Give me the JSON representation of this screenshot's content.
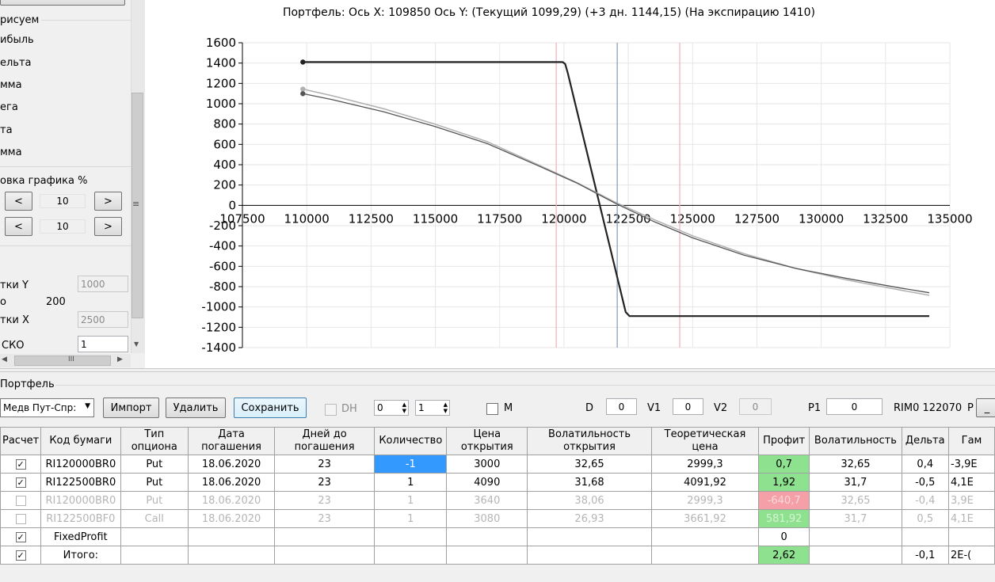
{
  "left_panel": {
    "group_title": "рисуем",
    "items": [
      "ибыль",
      "ельта",
      "мма",
      "ега",
      "та",
      "мма"
    ],
    "zoom_title": "овка графика %",
    "zoom_x": {
      "dec": "<",
      "value": "10",
      "inc": ">"
    },
    "zoom_y": {
      "dec": "<",
      "value": "10",
      "inc": ">"
    },
    "grid_y_label": "тки Y",
    "grid_y_value": "1000",
    "o_label": "о",
    "o_value": "200",
    "grid_x_label": "тки X",
    "grid_x_value": "2500",
    "sko_label": "СКО",
    "sko_value": "1",
    "hscroll_grip": "III",
    "vscroll_grip": "≡"
  },
  "chart": {
    "title": "Портфель: Ось X: 109850 Ось Y:  (Текущий 1099,29)  (+3 дн. 1144,15)  (На экспирацию 1410)"
  },
  "chart_data": {
    "type": "line",
    "title": "Портфель: Ось X: 109850 Ось Y:  (Текущий 1099,29)  (+3 дн. 1144,15)  (На экспирацию 1410)",
    "xlim": [
      107500,
      135000
    ],
    "ylim": [
      -1400,
      1600
    ],
    "x_ticks": [
      "107500",
      "110000",
      "112500",
      "115000",
      "117500",
      "120000",
      "122500",
      "125000",
      "127500",
      "130000",
      "132500",
      "135000"
    ],
    "y_ticks": [
      "1600",
      "1400",
      "1200",
      "1000",
      "800",
      "600",
      "400",
      "200",
      "0",
      "-200",
      "-400",
      "-600",
      "-800",
      "-1000",
      "-1200",
      "-1400"
    ],
    "grid": true,
    "vlines": [
      {
        "x": 119700,
        "color": "#f4b3bd"
      },
      {
        "x": 122070,
        "color": "#8aa0b6"
      },
      {
        "x": 124500,
        "color": "#f4b3bd"
      }
    ],
    "series": [
      {
        "color": "#222222",
        "width": 2.2,
        "marker_start": true,
        "points": [
          [
            109850,
            1410
          ],
          [
            119950,
            1410
          ],
          [
            120050,
            1390
          ],
          [
            120150,
            1300
          ],
          [
            122400,
            -1050
          ],
          [
            122550,
            -1090
          ],
          [
            134200,
            -1090
          ]
        ]
      },
      {
        "color": "#b0b0b0",
        "width": 1.5,
        "marker_start": true,
        "points": [
          [
            109850,
            1144
          ],
          [
            111000,
            1078
          ],
          [
            113000,
            950
          ],
          [
            115000,
            798
          ],
          [
            117000,
            628
          ],
          [
            119000,
            400
          ],
          [
            120500,
            225
          ],
          [
            122000,
            30
          ],
          [
            123500,
            -140
          ],
          [
            125000,
            -300
          ],
          [
            127000,
            -475
          ],
          [
            129000,
            -620
          ],
          [
            131000,
            -735
          ],
          [
            133000,
            -830
          ],
          [
            134200,
            -885
          ]
        ]
      },
      {
        "color": "#555555",
        "width": 1.3,
        "marker_start": true,
        "points": [
          [
            109850,
            1099
          ],
          [
            111000,
            1040
          ],
          [
            113000,
            920
          ],
          [
            115000,
            775
          ],
          [
            117000,
            610
          ],
          [
            119000,
            390
          ],
          [
            120500,
            220
          ],
          [
            122000,
            20
          ],
          [
            123500,
            -160
          ],
          [
            125000,
            -320
          ],
          [
            127000,
            -490
          ],
          [
            129000,
            -620
          ],
          [
            131000,
            -720
          ],
          [
            133000,
            -810
          ],
          [
            134200,
            -860
          ]
        ]
      }
    ]
  },
  "portfolio": {
    "title": "Портфель",
    "select_value": "Медв Пут-Спр:",
    "import_label": "Импорт",
    "delete_label": "Удалить",
    "save_label": "Сохранить",
    "dh_label": "DH",
    "spin1": "0",
    "spin2": "1",
    "m_label": "M",
    "d_label": "D",
    "d_value": "0",
    "v1_label": "V1",
    "v1_value": "0",
    "v2_label": "V2",
    "v2_value": "0",
    "p1_label": "P1",
    "p1_value": "0",
    "rim_label": "RIM0 122070",
    "p_label": "P",
    "p_btn": "_"
  },
  "table": {
    "headers": [
      "Расчет",
      "Код бумаги",
      "Тип\nопциона",
      "Дата\nпогашения",
      "Дней до\nпогашения",
      "Количество",
      "Цена\nоткрытия",
      "Волатильность\nоткрытия",
      "Теоретическая\nцена",
      "Профит",
      "Волатильность",
      "Дельта",
      "Гам"
    ],
    "rows": [
      {
        "cb": "✓",
        "code": "RI120000BR0",
        "type": "Put",
        "date": "18.06.2020",
        "days": "23",
        "qty": "-1",
        "price": "3000",
        "vol_open": "32,65",
        "theor": "2999,3",
        "profit": "0,7",
        "vol": "32,65",
        "delta": "0,4",
        "gamma": "-3,9E"
      },
      {
        "cb": "✓",
        "code": "RI122500BR0",
        "type": "Put",
        "date": "18.06.2020",
        "days": "23",
        "qty": "1",
        "price": "4090",
        "vol_open": "31,68",
        "theor": "4091,92",
        "profit": "1,92",
        "vol": "31,7",
        "delta": "-0,5",
        "gamma": "4,1E"
      },
      {
        "cb": "",
        "code": "RI120000BR0",
        "type": "Put",
        "date": "18.06.2020",
        "days": "23",
        "qty": "1",
        "price": "3640",
        "vol_open": "38,06",
        "theor": "2999,3",
        "profit": "-640,7",
        "vol": "32,65",
        "delta": "-0,4",
        "gamma": "3,9E"
      },
      {
        "cb": "",
        "code": "RI122500BF0",
        "type": "Call",
        "date": "18.06.2020",
        "days": "23",
        "qty": "1",
        "price": "3080",
        "vol_open": "26,93",
        "theor": "3661,92",
        "profit": "581,92",
        "vol": "31,7",
        "delta": "0,5",
        "gamma": "4,1E"
      },
      {
        "cb": "✓",
        "code": "FixedProfit",
        "type": "",
        "date": "",
        "days": "",
        "qty": "",
        "price": "",
        "vol_open": "",
        "theor": "",
        "profit": "0",
        "vol": "",
        "delta": "",
        "gamma": ""
      },
      {
        "cb": "✓",
        "code": "Итого:",
        "type": "",
        "date": "",
        "days": "",
        "qty": "",
        "price": "",
        "vol_open": "",
        "theor": "",
        "profit": "2,62",
        "vol": "",
        "delta": "-0,1",
        "gamma": "2E-("
      }
    ]
  }
}
